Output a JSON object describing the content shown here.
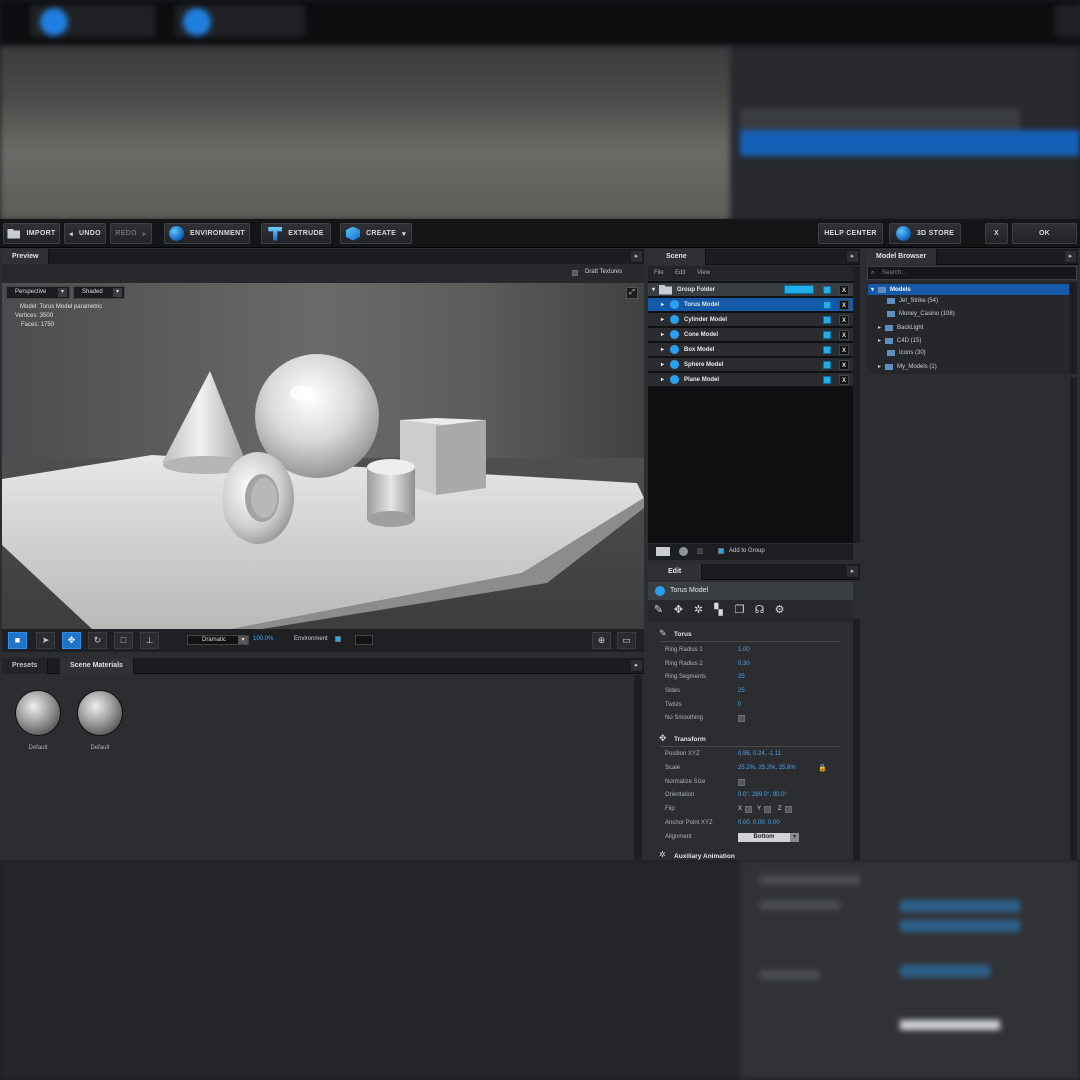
{
  "toolbar": {
    "import": "IMPORT",
    "undo": "UNDO",
    "redo": "REDO",
    "environment": "ENVIRONMENT",
    "extrude": "EXTRUDE",
    "create": "CREATE",
    "help_center": "HELP CENTER",
    "store": "3D STORE",
    "close": "X",
    "ok": "OK"
  },
  "preview": {
    "tab": "Preview",
    "draft_textures": "Draft Textures",
    "camera": "Perspective",
    "render_mode": "Shaded",
    "info_model": "Model:  Torus Model parametric",
    "info_vertices": "Vertices:  3500",
    "info_faces": "Faces:  1750",
    "lighting": "Dramatic",
    "zoom": "100.0%",
    "environment_label": "Environment"
  },
  "materials": {
    "tabs": [
      "Presets",
      "Scene Materials"
    ],
    "items": [
      {
        "label": "Default"
      },
      {
        "label": "Default"
      }
    ]
  },
  "scene": {
    "tab": "Scene",
    "menu": [
      "File",
      "Edit",
      "View"
    ],
    "group": "Group Folder",
    "items": [
      {
        "label": "Torus Model",
        "selected": true
      },
      {
        "label": "Cylinder Model",
        "selected": false
      },
      {
        "label": "Cone Model",
        "selected": false
      },
      {
        "label": "Box Model",
        "selected": false
      },
      {
        "label": "Sphere Model",
        "selected": false
      },
      {
        "label": "Plane Model",
        "selected": false
      }
    ],
    "add_to_group": "Add to Group"
  },
  "edit": {
    "tab": "Edit",
    "title": "Torus Model",
    "torus": {
      "header": "Torus",
      "ring_radius_1": {
        "label": "Ring Radius 1",
        "value": "1.00"
      },
      "ring_radius_2": {
        "label": "Ring Radius 2",
        "value": "0.30"
      },
      "ring_segments": {
        "label": "Ring Segments",
        "value": "25"
      },
      "sides": {
        "label": "Sides",
        "value": "25"
      },
      "twists": {
        "label": "Twists",
        "value": "0"
      },
      "no_smoothing": {
        "label": "No Smoothing"
      }
    },
    "transform": {
      "header": "Transform",
      "position": {
        "label": "Position XYZ",
        "value": "0.96,  0.24,  -1.11"
      },
      "scale": {
        "label": "Scale",
        "value": "25.2%,  25.2%,  25.8%"
      },
      "normalize": {
        "label": "Normalize Size"
      },
      "orientation": {
        "label": "Orientation",
        "value": "0.0°,  289.0°,  90.0°"
      },
      "flip": {
        "label": "Flip",
        "x": "X",
        "y": "Y",
        "z": "Z"
      },
      "anchor": {
        "label": "Anchor Point XYZ",
        "value": "0.00,  0.00,  0.00"
      },
      "alignment": {
        "label": "Alignment",
        "value": "Bottom"
      }
    },
    "aux": "Auxiliary Animation"
  },
  "browser": {
    "tab": "Model Browser",
    "search_placeholder": "Search...",
    "root": "Models",
    "items": [
      "Jet_Strike (54)",
      "Money_Casino (108)",
      "BackLight",
      "C4D (15)",
      "Icons (30)",
      "My_Models (1)"
    ]
  }
}
